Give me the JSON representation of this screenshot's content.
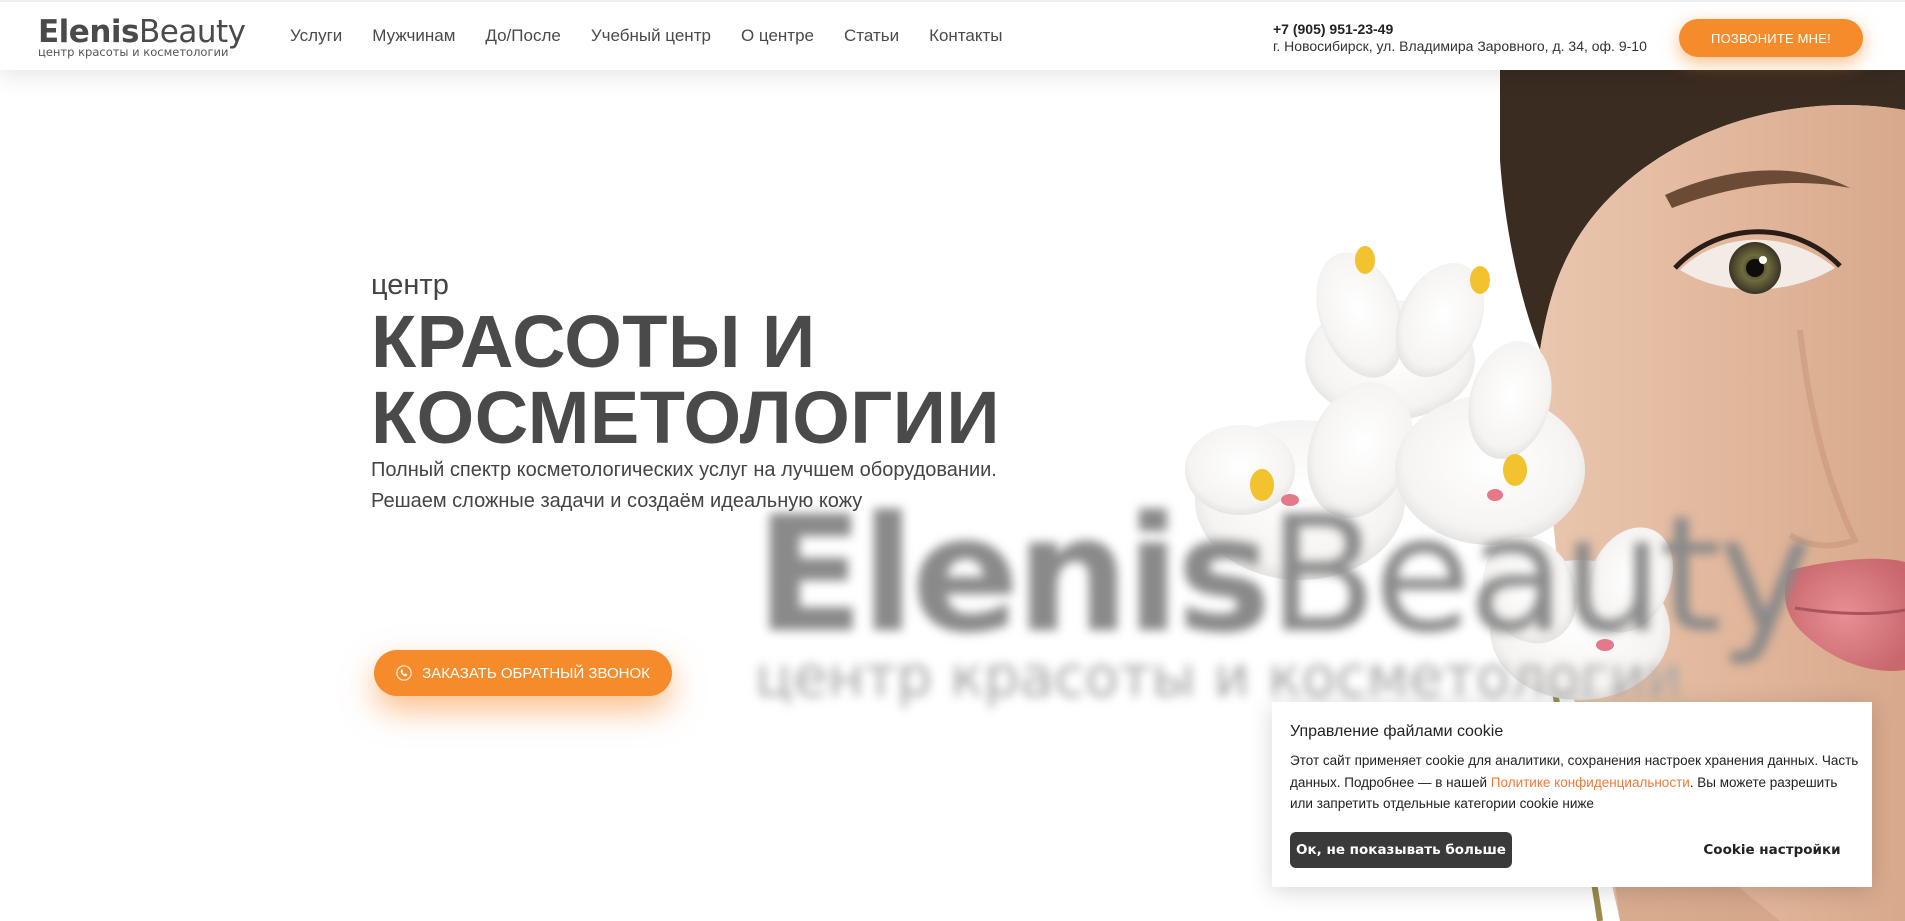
{
  "header": {
    "logo": {
      "part1": "Elenis",
      "part2": "Beauty",
      "tagline": "центр красоты и косметологии"
    },
    "nav": [
      {
        "label": "Услуги"
      },
      {
        "label": "Мужчинам"
      },
      {
        "label": "До/После"
      },
      {
        "label": "Учебный центр"
      },
      {
        "label": "О центре"
      },
      {
        "label": "Статьи"
      },
      {
        "label": "Контакты"
      }
    ],
    "phone": "+7 (905) 951-23-49",
    "address": "г. Новосибирск, ул. Владимира Заровного, д. 34, оф. 9-10",
    "call_button": "ПОЗВОНИТЕ МНЕ!"
  },
  "hero": {
    "kicker": "центр",
    "title_line1": "КРАСОТЫ И",
    "title_line2": "КОСМЕТОЛОГИИ",
    "desc_line1": "Полный спектр косметологических услуг на лучшем оборудовании.",
    "desc_line2": "Решаем сложные задачи и создаём идеальную кожу",
    "order_button": "ЗАКАЗАТЬ ОБРАТНЫЙ ЗВОНОК",
    "order_icon": "phone-icon"
  },
  "watermark": {
    "part1": "Elenis",
    "part2": "Beauty",
    "tagline": "центр красоты и косметологии"
  },
  "cookie": {
    "title": "Управление файлами cookie",
    "text_before": "Этот сайт применяет cookie для аналитики, сохранения настроек хранения данных. Часть данных. Подробнее — в нашей ",
    "link": "Политике конфиденциальности",
    "text_after": ". Вы можете разрешить или запретить отдельные категории cookie ниже",
    "ok_button": "Ок, не показывать больше",
    "settings_button": "Cookie настройки"
  },
  "colors": {
    "accent": "#f58b2b",
    "text": "#4a4a4a",
    "link": "#f07a37",
    "dark_button": "#3a3a3a"
  }
}
